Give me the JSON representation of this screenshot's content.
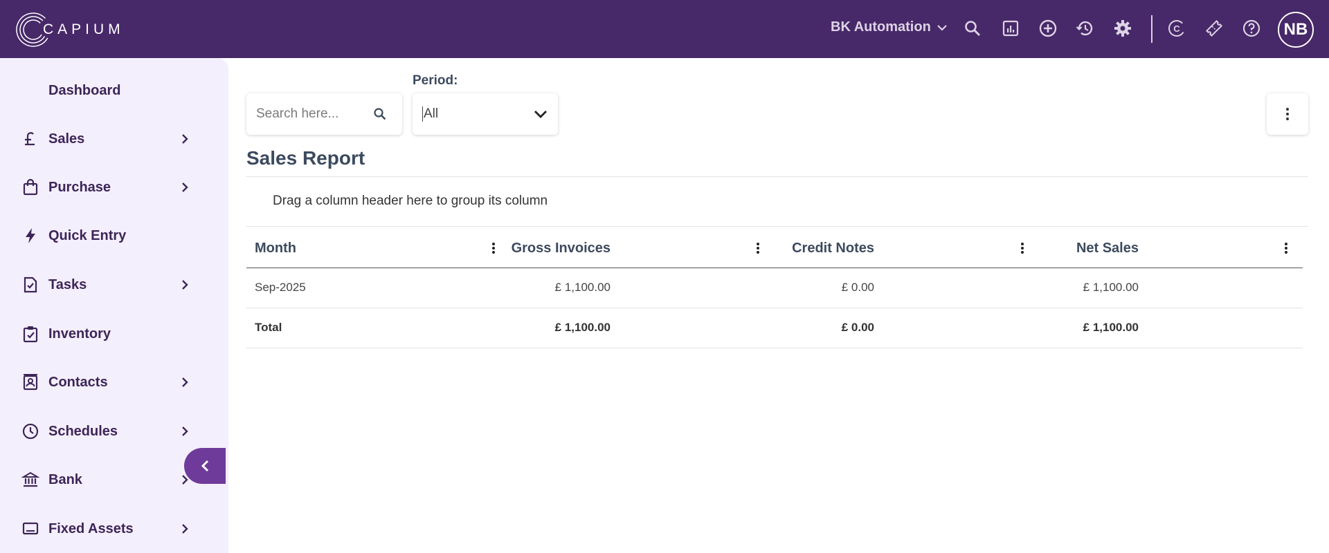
{
  "app": {
    "logo_text": "CAPIUM",
    "company_name": "BK Automation",
    "user_initials": "NB"
  },
  "topbar_icons": [
    "search-icon",
    "report-icon",
    "add-circle-icon",
    "history-icon",
    "settings-icon",
    "capium-c-icon",
    "ticket-icon",
    "help-icon"
  ],
  "sidebar": {
    "items": [
      {
        "label": "Dashboard",
        "icon": "dashboard-icon",
        "has_arrow": false
      },
      {
        "label": "Sales",
        "icon": "pound-icon",
        "has_arrow": true
      },
      {
        "label": "Purchase",
        "icon": "bag-icon",
        "has_arrow": true
      },
      {
        "label": "Quick Entry",
        "icon": "bolt-icon",
        "has_arrow": false
      },
      {
        "label": "Tasks",
        "icon": "task-check-icon",
        "has_arrow": true
      },
      {
        "label": "Inventory",
        "icon": "clipboard-check-icon",
        "has_arrow": false
      },
      {
        "label": "Contacts",
        "icon": "contacts-icon",
        "has_arrow": true
      },
      {
        "label": "Schedules",
        "icon": "clock-icon",
        "has_arrow": true
      },
      {
        "label": "Bank",
        "icon": "bank-icon",
        "has_arrow": true
      },
      {
        "label": "Fixed Assets",
        "icon": "laptop-icon",
        "has_arrow": true
      }
    ]
  },
  "toolbar": {
    "search_placeholder": "Search here...",
    "period_label": "Period:",
    "period_value": "All"
  },
  "report": {
    "title": "Sales Report",
    "group_hint": "Drag a column header here to group its column"
  },
  "grid": {
    "columns": [
      "Month",
      "Gross Invoices",
      "Credit Notes",
      "Net Sales"
    ],
    "rows": [
      {
        "month": "Sep-2025",
        "gross": "£ 1,100.00",
        "credit": "£ 0.00",
        "net": "£ 1,100.00"
      }
    ],
    "total": {
      "label": "Total",
      "gross": "£ 1,100.00",
      "credit": "£ 0.00",
      "net": "£ 1,100.00"
    }
  },
  "colors": {
    "topbar": "#472868",
    "sidebar": "#f4effc",
    "sidebar_text": "#3d2558",
    "collapse_button": "#6e3b9a",
    "heading": "#3c4a5e"
  }
}
